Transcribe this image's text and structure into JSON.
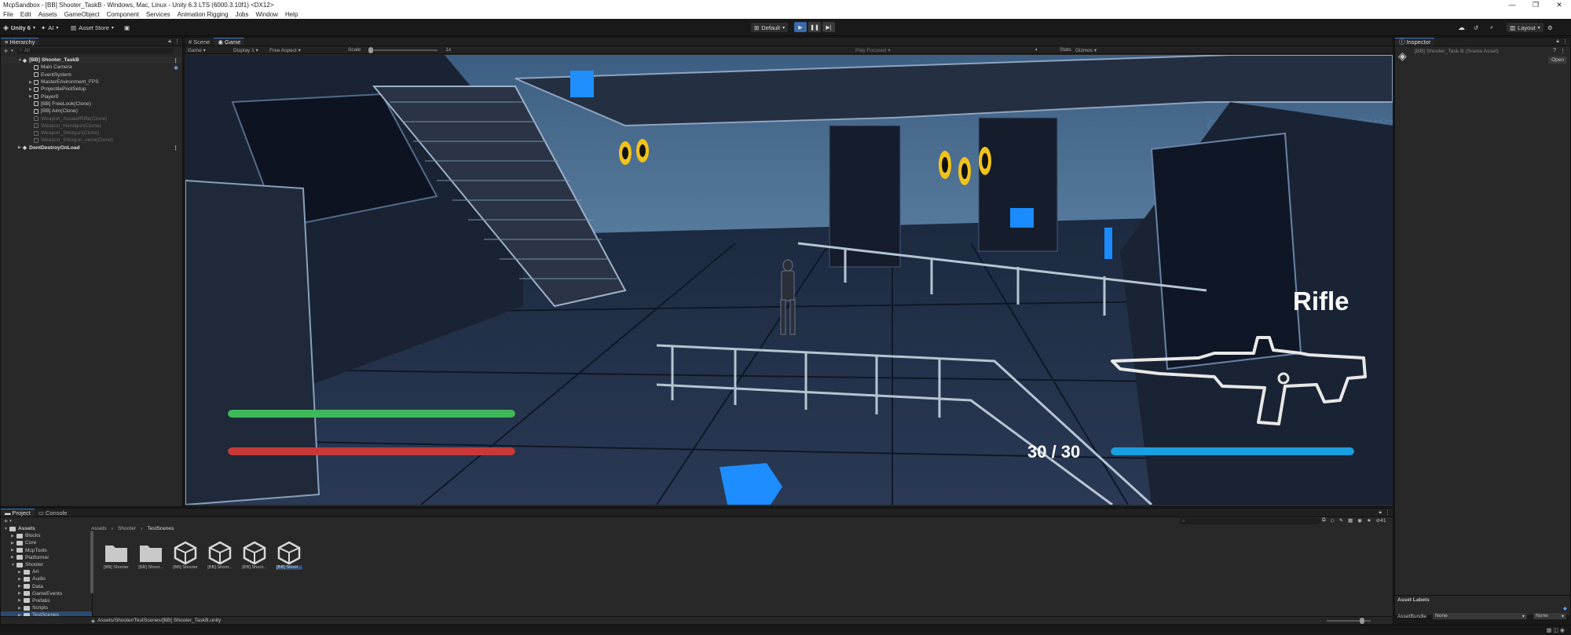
{
  "window": {
    "title": "McpSandbox - [BB] Shooter_TaskB - Windows, Mac, Linux - Unity 6.3 LTS (6000.3.10f1) <DX12>",
    "controls": [
      "—",
      "❐",
      "✕"
    ]
  },
  "menu": [
    "File",
    "Edit",
    "Assets",
    "GameObject",
    "Component",
    "Services",
    "Animation Rigging",
    "Jobs",
    "Window",
    "Help"
  ],
  "toolbar": {
    "account": "Unity 6",
    "ai": "AI",
    "asset_store": "Asset Store",
    "layout_default": "Default",
    "layout": "Layout"
  },
  "hierarchy": {
    "tab": "Hierarchy",
    "search_placeholder": "All",
    "scene": "[BB] Shooter_TaskB",
    "items": [
      {
        "label": "Main Camera",
        "dim": false
      },
      {
        "label": "EventSystem",
        "dim": false
      },
      {
        "label": "MasterEnvironment_FPS",
        "dim": false
      },
      {
        "label": "ProjectilePoolSetup",
        "dim": false
      },
      {
        "label": "Player0",
        "dim": false
      },
      {
        "label": "[BB] FreeLook(Clone)",
        "dim": false
      },
      {
        "label": "[BB] Aim(Clone)",
        "dim": false
      },
      {
        "label": "Weapon_AssaultRifle(Clone)",
        "dim": true
      },
      {
        "label": "Weapon_Handgun(Clone)",
        "dim": true
      },
      {
        "label": "Weapon_Shotgun(Clone)",
        "dim": true
      },
      {
        "label": "Weapon_Shotgun_semi(Clone)",
        "dim": true
      }
    ],
    "dont_destroy": "DontDestroyOnLoad"
  },
  "game_view": {
    "tabs": [
      "Scene",
      "Game"
    ],
    "mode": "Game",
    "display": "Display 1",
    "aspect": "Free Aspect",
    "scale_label": "Scale",
    "scale_value": "1x",
    "play_focused": "Play Focused",
    "stats": "Stats",
    "gizmos": "Gizmos"
  },
  "hud": {
    "weapon_name": "Rifle",
    "ammo": "30 / 30",
    "health_fraction": 1.0,
    "ammo_fraction": 1.0,
    "health_color": "#3fb85a",
    "secondary_color": "#c83a3a",
    "ammo_color": "#1a9fe0"
  },
  "inspector": {
    "tab": "Inspector",
    "title": "[BB] Shooter_Task B (Scene Asset)",
    "open": "Open",
    "asset_labels": "Asset Labels",
    "asset_bundle_label": "AssetBundle",
    "asset_bundle_value": "None",
    "asset_bundle_variant": "None"
  },
  "project": {
    "tabs": [
      "Project",
      "Console"
    ],
    "breadcrumb": [
      "Assets",
      "Shooter",
      "TestScenes"
    ],
    "tree": [
      {
        "label": "Assets",
        "level": 0,
        "bold": true
      },
      {
        "label": "Blocks",
        "level": 1
      },
      {
        "label": "Core",
        "level": 1
      },
      {
        "label": "McpTools",
        "level": 1
      },
      {
        "label": "Platformer",
        "level": 1
      },
      {
        "label": "Shooter",
        "level": 1
      },
      {
        "label": "Art",
        "level": 2
      },
      {
        "label": "Audio",
        "level": 2
      },
      {
        "label": "Data",
        "level": 2
      },
      {
        "label": "GameEvents",
        "level": 2
      },
      {
        "label": "Prefabs",
        "level": 2
      },
      {
        "label": "Scripts",
        "level": 2
      },
      {
        "label": "TestScenes",
        "level": 2
      }
    ],
    "assets": [
      {
        "label": "[BB] Shooter",
        "type": "folder"
      },
      {
        "label": "[BB] Shoot...",
        "type": "folder"
      },
      {
        "label": "[BB] Shooter",
        "type": "scene"
      },
      {
        "label": "[BB] Shoot...",
        "type": "scene"
      },
      {
        "label": "[BB] Shoot...",
        "type": "scene"
      },
      {
        "label": "[BB] Shoot...",
        "type": "scene",
        "selected": true
      }
    ],
    "hidden_count": "41",
    "status_path": "Assets/Shooter/TestScenes/[BB] Shooter_TaskB.unity"
  }
}
